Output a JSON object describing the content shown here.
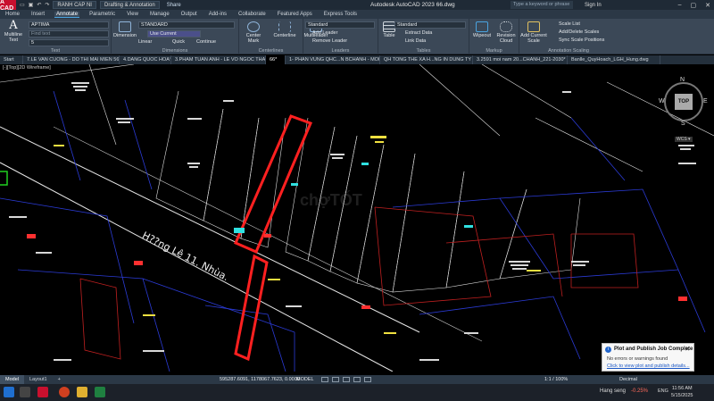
{
  "titlebar": {
    "logo": "A CAD",
    "workspace": "Drafting & Annotation",
    "share": "Share",
    "app_title": "Autodesk AutoCAD 2023    66.dwg",
    "search_placeholder": "Type a keyword or phrase",
    "signin": "Sign In",
    "layer_quick": "RANH CAP NI"
  },
  "menu_tabs": [
    "Home",
    "Insert",
    "Annotate",
    "Parametric",
    "View",
    "Manage",
    "Output",
    "Add-ins",
    "Collaborate",
    "Featured Apps",
    "Express Tools"
  ],
  "active_menu": "Annotate",
  "ribbon": {
    "text_group": {
      "multiline_text": "Multiline Text",
      "text_style": "APTIMA",
      "find_text": "Find text",
      "text_height": "5",
      "label": "Text"
    },
    "dimensions_group": {
      "dimension": "Dimension",
      "dim_style": "STANDARD",
      "use_current": "Use Current",
      "linear": "Linear",
      "quick": "Quick",
      "continue": "Continue",
      "label": "Dimensions"
    },
    "centerlines_group": {
      "center_mark": "Center Mark",
      "centerline": "Centerline",
      "label": "Centerlines"
    },
    "leaders_group": {
      "multileader": "Multileader",
      "style": "Standard",
      "add_leader": "Add Leader",
      "remove_leader": "Remove Leader",
      "label": "Leaders"
    },
    "tables_group": {
      "table": "Table",
      "style": "Standard",
      "extract_data": "Extract Data",
      "link_data": "Link Data",
      "label": "Tables"
    },
    "markup_group": {
      "wipeout": "Wipeout",
      "revision_cloud": "Revision Cloud",
      "label": "Markup"
    },
    "scaling_group": {
      "add_current_scale": "Add Current Scale",
      "scale_list": "Scale List",
      "add_delete_scales": "Add/Delete Scales",
      "sync_scale_positions": "Sync Scale Positions",
      "label": "Annotation Scaling"
    }
  },
  "doc_tabs": [
    "Start",
    "7.LE VAN CUONG - DO THI MAI MIEN 567",
    "4.DANG QUOC HOA*",
    "3.PHAM TUAN ANH - LE VO NGOC THAO*",
    "66*",
    "1- PHAN VUNG QHC...N BCHANH - MOI*",
    "QH TONG THE XA H...NG IN DUNG TY LE*",
    "3.2591 moi nam 20...CHANH_221-2030*",
    "Banlle_QuyHoach_LGH_Hung.dwg"
  ],
  "active_doc_tab": "66*",
  "viewport": {
    "label": "[-][Top][2D Wireframe]",
    "road_label": "H??ng Lê 11. Nhùa.",
    "watermark": "chợTỐT"
  },
  "viewcube": {
    "n": "N",
    "s": "S",
    "e": "E",
    "w": "W",
    "top": "TOP",
    "wcs": "WCS ▾"
  },
  "notification": {
    "title": "Plot and Publish Job Complete",
    "body": "No errors or warnings found",
    "link": "Click to view plot and publish details..."
  },
  "statusbar": {
    "tabs": [
      "Model",
      "Layout1",
      "+"
    ],
    "active_tab": "Model",
    "coords": "595287.6091, 1178067.7623, 0.0000",
    "model": "MODEL",
    "scale": "1:1 / 100%",
    "units": "Decimal"
  },
  "taskbar": {
    "stock_name": "Hang seng",
    "stock_change": "-0.25%",
    "lang": "ENG",
    "time": "11:56 AM",
    "date": "5/15/2025"
  }
}
